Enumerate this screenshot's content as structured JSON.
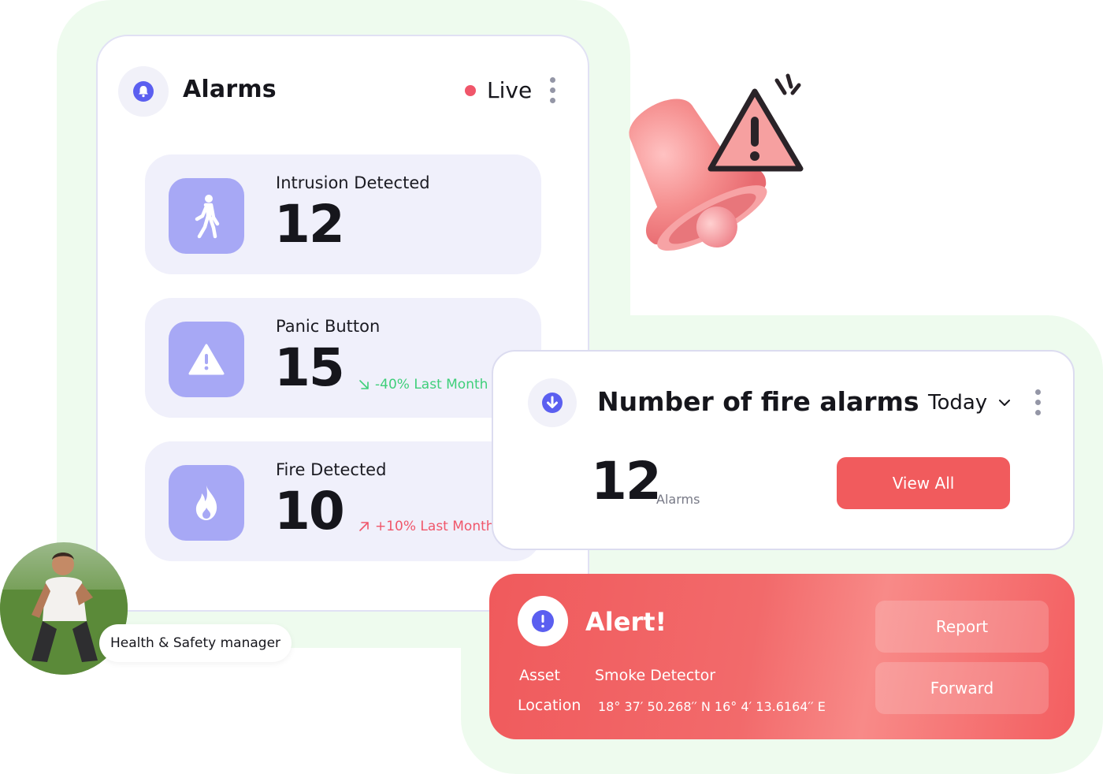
{
  "alarms_card": {
    "title": "Alarms",
    "live_label": "Live",
    "stats": [
      {
        "label": "Intrusion Detected",
        "value": "12",
        "icon": "walking-person-icon",
        "trend": ""
      },
      {
        "label": "Panic Button",
        "value": "15",
        "icon": "warning-triangle-icon",
        "trend": "-40% Last Month",
        "trend_direction": "down"
      },
      {
        "label": "Fire Detected",
        "value": "10",
        "icon": "flame-icon",
        "trend": "+10% Last Month",
        "trend_direction": "up"
      }
    ]
  },
  "fire_card": {
    "title": "Number of fire alarms",
    "period": "Today",
    "value": "12",
    "unit": "Alarms",
    "view_all_label": "View All"
  },
  "alert_card": {
    "title": "Alert!",
    "asset_label": "Asset",
    "asset_value": "Smoke Detector",
    "location_label": "Location",
    "location_value": "18° 37′ 50.268′′ N 16° 4′ 13.6164′′ E",
    "report_label": "Report",
    "forward_label": "Forward"
  },
  "person": {
    "role": "Health & Safety manager"
  },
  "colors": {
    "accent": "#5b5ff0",
    "live": "#f0566a",
    "danger": "#f15b5d",
    "trend_down": "#3fcf7a",
    "trend_up": "#f0566a",
    "stat_icon_bg": "#a7a8f5"
  }
}
